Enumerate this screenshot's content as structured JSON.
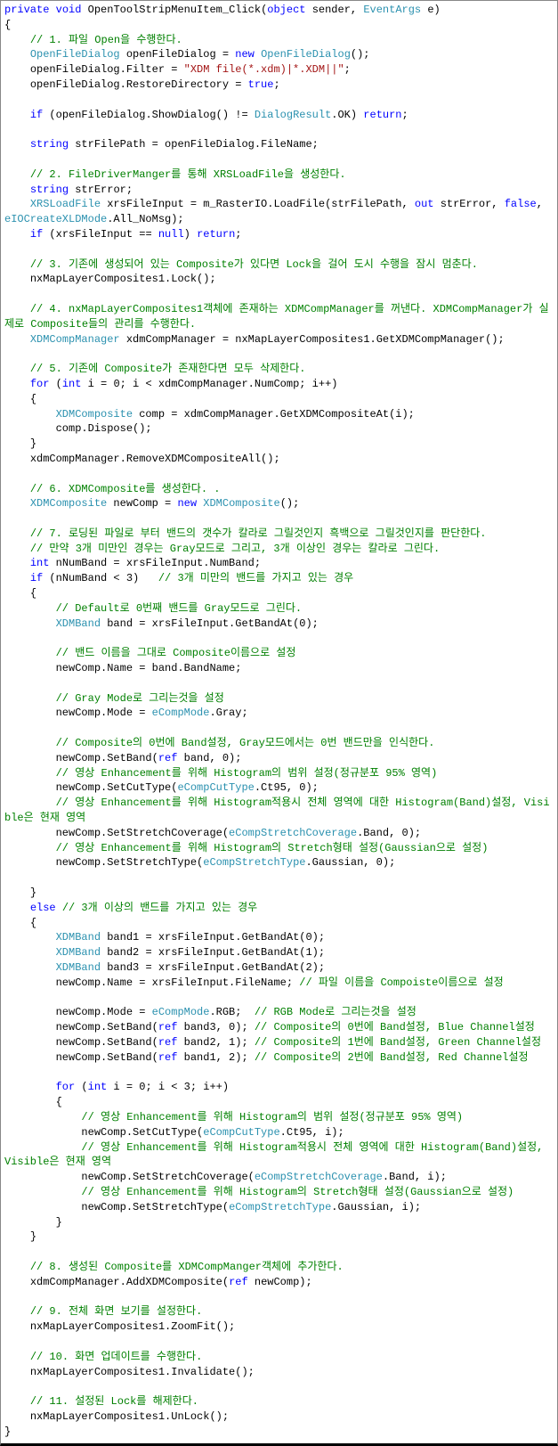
{
  "code": {
    "lines": [
      [
        {
          "t": "private",
          "c": "kw"
        },
        {
          "t": " ",
          "c": "plain"
        },
        {
          "t": "void",
          "c": "kw"
        },
        {
          "t": " OpenToolStripMenuItem_Click(",
          "c": "plain"
        },
        {
          "t": "object",
          "c": "kw"
        },
        {
          "t": " sender, ",
          "c": "plain"
        },
        {
          "t": "EventArgs",
          "c": "type"
        },
        {
          "t": " e)",
          "c": "plain"
        }
      ],
      [
        {
          "t": "{",
          "c": "plain"
        }
      ],
      [
        {
          "t": "    ",
          "c": "plain"
        },
        {
          "t": "// 1. 파일 Open을 수행한다.",
          "c": "cmt"
        }
      ],
      [
        {
          "t": "    ",
          "c": "plain"
        },
        {
          "t": "OpenFileDialog",
          "c": "type"
        },
        {
          "t": " openFileDialog = ",
          "c": "plain"
        },
        {
          "t": "new",
          "c": "kw"
        },
        {
          "t": " ",
          "c": "plain"
        },
        {
          "t": "OpenFileDialog",
          "c": "type"
        },
        {
          "t": "();",
          "c": "plain"
        }
      ],
      [
        {
          "t": "    openFileDialog.Filter = ",
          "c": "plain"
        },
        {
          "t": "\"XDM file(*.xdm)|*.XDM||\"",
          "c": "str"
        },
        {
          "t": ";",
          "c": "plain"
        }
      ],
      [
        {
          "t": "    openFileDialog.RestoreDirectory = ",
          "c": "plain"
        },
        {
          "t": "true",
          "c": "kw"
        },
        {
          "t": ";",
          "c": "plain"
        }
      ],
      [
        {
          "t": " ",
          "c": "plain"
        }
      ],
      [
        {
          "t": "    ",
          "c": "plain"
        },
        {
          "t": "if",
          "c": "kw"
        },
        {
          "t": " (openFileDialog.ShowDialog() != ",
          "c": "plain"
        },
        {
          "t": "DialogResult",
          "c": "type"
        },
        {
          "t": ".OK) ",
          "c": "plain"
        },
        {
          "t": "return",
          "c": "kw"
        },
        {
          "t": ";",
          "c": "plain"
        }
      ],
      [
        {
          "t": " ",
          "c": "plain"
        }
      ],
      [
        {
          "t": "    ",
          "c": "plain"
        },
        {
          "t": "string",
          "c": "kw"
        },
        {
          "t": " strFilePath = openFileDialog.FileName;",
          "c": "plain"
        }
      ],
      [
        {
          "t": " ",
          "c": "plain"
        }
      ],
      [
        {
          "t": "    ",
          "c": "plain"
        },
        {
          "t": "// 2. FileDriverManger를 통해 XRSLoadFile을 생성한다.",
          "c": "cmt"
        }
      ],
      [
        {
          "t": "    ",
          "c": "plain"
        },
        {
          "t": "string",
          "c": "kw"
        },
        {
          "t": " strError;",
          "c": "plain"
        }
      ],
      [
        {
          "t": "    ",
          "c": "plain"
        },
        {
          "t": "XRSLoadFile",
          "c": "type"
        },
        {
          "t": " xrsFileInput = m_RasterIO.LoadFile(strFilePath, ",
          "c": "plain"
        },
        {
          "t": "out",
          "c": "kw"
        },
        {
          "t": " strError, ",
          "c": "plain"
        },
        {
          "t": "false",
          "c": "kw"
        },
        {
          "t": ", ",
          "c": "plain"
        },
        {
          "t": "eIOCreateXLDMode",
          "c": "type"
        },
        {
          "t": ".All_NoMsg);",
          "c": "plain"
        }
      ],
      [
        {
          "t": "    ",
          "c": "plain"
        },
        {
          "t": "if",
          "c": "kw"
        },
        {
          "t": " (xrsFileInput == ",
          "c": "plain"
        },
        {
          "t": "null",
          "c": "kw"
        },
        {
          "t": ") ",
          "c": "plain"
        },
        {
          "t": "return",
          "c": "kw"
        },
        {
          "t": ";",
          "c": "plain"
        }
      ],
      [
        {
          "t": " ",
          "c": "plain"
        }
      ],
      [
        {
          "t": "    ",
          "c": "plain"
        },
        {
          "t": "// 3. 기존에 생성되어 있는 Composite가 있다면 Lock을 걸어 도시 수행을 잠시 멈춘다.",
          "c": "cmt"
        }
      ],
      [
        {
          "t": "    nxMapLayerComposites1.Lock();",
          "c": "plain"
        }
      ],
      [
        {
          "t": " ",
          "c": "plain"
        }
      ],
      [
        {
          "t": "    ",
          "c": "plain"
        },
        {
          "t": "// 4. nxMapLayerComposites1객체에 존재하는 XDMCompManager를 꺼낸다. XDMCompManager가 실제로 Composite들의 관리를 수행한다.",
          "c": "cmt"
        }
      ],
      [
        {
          "t": "    ",
          "c": "plain"
        },
        {
          "t": "XDMCompManager",
          "c": "type"
        },
        {
          "t": " xdmCompManager = nxMapLayerComposites1.GetXDMCompManager();",
          "c": "plain"
        }
      ],
      [
        {
          "t": " ",
          "c": "plain"
        }
      ],
      [
        {
          "t": "    ",
          "c": "plain"
        },
        {
          "t": "// 5. 기존에 Composite가 존재한다면 모두 삭제한다.",
          "c": "cmt"
        }
      ],
      [
        {
          "t": "    ",
          "c": "plain"
        },
        {
          "t": "for",
          "c": "kw"
        },
        {
          "t": " (",
          "c": "plain"
        },
        {
          "t": "int",
          "c": "kw"
        },
        {
          "t": " i = 0; i < xdmCompManager.NumComp; i++)",
          "c": "plain"
        }
      ],
      [
        {
          "t": "    {",
          "c": "plain"
        }
      ],
      [
        {
          "t": "        ",
          "c": "plain"
        },
        {
          "t": "XDMComposite",
          "c": "type"
        },
        {
          "t": " comp = xdmCompManager.GetXDMCompositeAt(i);",
          "c": "plain"
        }
      ],
      [
        {
          "t": "        comp.Dispose();",
          "c": "plain"
        }
      ],
      [
        {
          "t": "    }",
          "c": "plain"
        }
      ],
      [
        {
          "t": "    xdmCompManager.RemoveXDMCompositeAll();",
          "c": "plain"
        }
      ],
      [
        {
          "t": " ",
          "c": "plain"
        }
      ],
      [
        {
          "t": "    ",
          "c": "plain"
        },
        {
          "t": "// 6. XDMComposite를 생성한다. .",
          "c": "cmt"
        }
      ],
      [
        {
          "t": "    ",
          "c": "plain"
        },
        {
          "t": "XDMComposite",
          "c": "type"
        },
        {
          "t": " newComp = ",
          "c": "plain"
        },
        {
          "t": "new",
          "c": "kw"
        },
        {
          "t": " ",
          "c": "plain"
        },
        {
          "t": "XDMComposite",
          "c": "type"
        },
        {
          "t": "();",
          "c": "plain"
        }
      ],
      [
        {
          "t": " ",
          "c": "plain"
        }
      ],
      [
        {
          "t": "    ",
          "c": "plain"
        },
        {
          "t": "// 7. 로딩된 파일로 부터 밴드의 갯수가 칼라로 그릴것인지 흑백으로 그릴것인지를 판단한다.",
          "c": "cmt"
        }
      ],
      [
        {
          "t": "    ",
          "c": "plain"
        },
        {
          "t": "// 만약 3개 미만인 경우는 Gray모드로 그리고, 3개 이상인 경우는 칼라로 그린다.",
          "c": "cmt"
        }
      ],
      [
        {
          "t": "    ",
          "c": "plain"
        },
        {
          "t": "int",
          "c": "kw"
        },
        {
          "t": " nNumBand = xrsFileInput.NumBand;",
          "c": "plain"
        }
      ],
      [
        {
          "t": "    ",
          "c": "plain"
        },
        {
          "t": "if",
          "c": "kw"
        },
        {
          "t": " (nNumBand < 3)   ",
          "c": "plain"
        },
        {
          "t": "// 3개 미만의 밴드를 가지고 있는 경우",
          "c": "cmt"
        }
      ],
      [
        {
          "t": "    {",
          "c": "plain"
        }
      ],
      [
        {
          "t": "        ",
          "c": "plain"
        },
        {
          "t": "// Default로 0번째 밴드를 Gray모드로 그린다.",
          "c": "cmt"
        }
      ],
      [
        {
          "t": "        ",
          "c": "plain"
        },
        {
          "t": "XDMBand",
          "c": "type"
        },
        {
          "t": " band = xrsFileInput.GetBandAt(0);",
          "c": "plain"
        }
      ],
      [
        {
          "t": " ",
          "c": "plain"
        }
      ],
      [
        {
          "t": "        ",
          "c": "plain"
        },
        {
          "t": "// 밴드 이름을 그대로 Composite이름으로 설정",
          "c": "cmt"
        }
      ],
      [
        {
          "t": "        newComp.Name = band.BandName;",
          "c": "plain"
        }
      ],
      [
        {
          "t": " ",
          "c": "plain"
        }
      ],
      [
        {
          "t": "        ",
          "c": "plain"
        },
        {
          "t": "// Gray Mode로 그리는것을 설정",
          "c": "cmt"
        }
      ],
      [
        {
          "t": "        newComp.Mode = ",
          "c": "plain"
        },
        {
          "t": "eCompMode",
          "c": "type"
        },
        {
          "t": ".Gray;",
          "c": "plain"
        }
      ],
      [
        {
          "t": " ",
          "c": "plain"
        }
      ],
      [
        {
          "t": "        ",
          "c": "plain"
        },
        {
          "t": "// Composite의 0번에 Band설정, Gray모드에서는 0번 밴드만을 인식한다.",
          "c": "cmt"
        }
      ],
      [
        {
          "t": "        newComp.SetBand(",
          "c": "plain"
        },
        {
          "t": "ref",
          "c": "kw"
        },
        {
          "t": " band, 0);",
          "c": "plain"
        }
      ],
      [
        {
          "t": "        ",
          "c": "plain"
        },
        {
          "t": "// 영상 Enhancement를 위해 Histogram의 범위 설정(정규분포 95% 영역)",
          "c": "cmt"
        }
      ],
      [
        {
          "t": "        newComp.SetCutType(",
          "c": "plain"
        },
        {
          "t": "eCompCutType",
          "c": "type"
        },
        {
          "t": ".Ct95, 0);",
          "c": "plain"
        }
      ],
      [
        {
          "t": "        ",
          "c": "plain"
        },
        {
          "t": "// 영상 Enhancement를 위해 Histogram적용시 전체 영역에 대한 Histogram(Band)설정, Visible은 현재 영역",
          "c": "cmt"
        }
      ],
      [
        {
          "t": "        newComp.SetStretchCoverage(",
          "c": "plain"
        },
        {
          "t": "eCompStretchCoverage",
          "c": "type"
        },
        {
          "t": ".Band, 0);",
          "c": "plain"
        }
      ],
      [
        {
          "t": "        ",
          "c": "plain"
        },
        {
          "t": "// 영상 Enhancement를 위해 Histogram의 Stretch형태 설정(Gaussian으로 설정)",
          "c": "cmt"
        }
      ],
      [
        {
          "t": "        newComp.SetStretchType(",
          "c": "plain"
        },
        {
          "t": "eCompStretchType",
          "c": "type"
        },
        {
          "t": ".Gaussian, 0);",
          "c": "plain"
        }
      ],
      [
        {
          "t": " ",
          "c": "plain"
        }
      ],
      [
        {
          "t": "    }",
          "c": "plain"
        }
      ],
      [
        {
          "t": "    ",
          "c": "plain"
        },
        {
          "t": "else",
          "c": "kw"
        },
        {
          "t": " ",
          "c": "plain"
        },
        {
          "t": "// 3개 이상의 밴드를 가지고 있는 경우",
          "c": "cmt"
        }
      ],
      [
        {
          "t": "    {",
          "c": "plain"
        }
      ],
      [
        {
          "t": "        ",
          "c": "plain"
        },
        {
          "t": "XDMBand",
          "c": "type"
        },
        {
          "t": " band1 = xrsFileInput.GetBandAt(0);",
          "c": "plain"
        }
      ],
      [
        {
          "t": "        ",
          "c": "plain"
        },
        {
          "t": "XDMBand",
          "c": "type"
        },
        {
          "t": " band2 = xrsFileInput.GetBandAt(1);",
          "c": "plain"
        }
      ],
      [
        {
          "t": "        ",
          "c": "plain"
        },
        {
          "t": "XDMBand",
          "c": "type"
        },
        {
          "t": " band3 = xrsFileInput.GetBandAt(2);",
          "c": "plain"
        }
      ],
      [
        {
          "t": "        newComp.Name = xrsFileInput.FileName; ",
          "c": "plain"
        },
        {
          "t": "// 파일 이름을 Compoiste이름으로 설정",
          "c": "cmt"
        }
      ],
      [
        {
          "t": " ",
          "c": "plain"
        }
      ],
      [
        {
          "t": "        newComp.Mode = ",
          "c": "plain"
        },
        {
          "t": "eCompMode",
          "c": "type"
        },
        {
          "t": ".RGB;  ",
          "c": "plain"
        },
        {
          "t": "// RGB Mode로 그리는것을 설정",
          "c": "cmt"
        }
      ],
      [
        {
          "t": "        newComp.SetBand(",
          "c": "plain"
        },
        {
          "t": "ref",
          "c": "kw"
        },
        {
          "t": " band3, 0); ",
          "c": "plain"
        },
        {
          "t": "// Composite의 0번에 Band설정, Blue Channel설정",
          "c": "cmt"
        }
      ],
      [
        {
          "t": "        newComp.SetBand(",
          "c": "plain"
        },
        {
          "t": "ref",
          "c": "kw"
        },
        {
          "t": " band2, 1); ",
          "c": "plain"
        },
        {
          "t": "// Composite의 1번에 Band설정, Green Channel설정",
          "c": "cmt"
        }
      ],
      [
        {
          "t": "        newComp.SetBand(",
          "c": "plain"
        },
        {
          "t": "ref",
          "c": "kw"
        },
        {
          "t": " band1, 2); ",
          "c": "plain"
        },
        {
          "t": "// Composite의 2번에 Band설정, Red Channel설정",
          "c": "cmt"
        }
      ],
      [
        {
          "t": " ",
          "c": "plain"
        }
      ],
      [
        {
          "t": "        ",
          "c": "plain"
        },
        {
          "t": "for",
          "c": "kw"
        },
        {
          "t": " (",
          "c": "plain"
        },
        {
          "t": "int",
          "c": "kw"
        },
        {
          "t": " i = 0; i < 3; i++)",
          "c": "plain"
        }
      ],
      [
        {
          "t": "        {",
          "c": "plain"
        }
      ],
      [
        {
          "t": "            ",
          "c": "plain"
        },
        {
          "t": "// 영상 Enhancement를 위해 Histogram의 범위 설정(정규분포 95% 영역)",
          "c": "cmt"
        }
      ],
      [
        {
          "t": "            newComp.SetCutType(",
          "c": "plain"
        },
        {
          "t": "eCompCutType",
          "c": "type"
        },
        {
          "t": ".Ct95, i);",
          "c": "plain"
        }
      ],
      [
        {
          "t": "            ",
          "c": "plain"
        },
        {
          "t": "// 영상 Enhancement를 위해 Histogram적용시 전체 영역에 대한 Histogram(Band)설정, Visible은 현재 영역",
          "c": "cmt"
        }
      ],
      [
        {
          "t": "            newComp.SetStretchCoverage(",
          "c": "plain"
        },
        {
          "t": "eCompStretchCoverage",
          "c": "type"
        },
        {
          "t": ".Band, i);",
          "c": "plain"
        }
      ],
      [
        {
          "t": "            ",
          "c": "plain"
        },
        {
          "t": "// 영상 Enhancement를 위해 Histogram의 Stretch형태 설정(Gaussian으로 설정)",
          "c": "cmt"
        }
      ],
      [
        {
          "t": "            newComp.SetStretchType(",
          "c": "plain"
        },
        {
          "t": "eCompStretchType",
          "c": "type"
        },
        {
          "t": ".Gaussian, i);",
          "c": "plain"
        }
      ],
      [
        {
          "t": "        }",
          "c": "plain"
        }
      ],
      [
        {
          "t": "    }",
          "c": "plain"
        }
      ],
      [
        {
          "t": " ",
          "c": "plain"
        }
      ],
      [
        {
          "t": "    ",
          "c": "plain"
        },
        {
          "t": "// 8. 생성된 Composite를 XDMCompManger객체에 추가한다.",
          "c": "cmt"
        }
      ],
      [
        {
          "t": "    xdmCompManager.AddXDMComposite(",
          "c": "plain"
        },
        {
          "t": "ref",
          "c": "kw"
        },
        {
          "t": " newComp);",
          "c": "plain"
        }
      ],
      [
        {
          "t": " ",
          "c": "plain"
        }
      ],
      [
        {
          "t": "    ",
          "c": "plain"
        },
        {
          "t": "// 9. 전체 화면 보기를 설정한다.",
          "c": "cmt"
        }
      ],
      [
        {
          "t": "    nxMapLayerComposites1.ZoomFit();",
          "c": "plain"
        }
      ],
      [
        {
          "t": " ",
          "c": "plain"
        }
      ],
      [
        {
          "t": "    ",
          "c": "plain"
        },
        {
          "t": "// 10. 화면 업데이트를 수행한다.",
          "c": "cmt"
        }
      ],
      [
        {
          "t": "    nxMapLayerComposites1.Invalidate();",
          "c": "plain"
        }
      ],
      [
        {
          "t": " ",
          "c": "plain"
        }
      ],
      [
        {
          "t": "    ",
          "c": "plain"
        },
        {
          "t": "// 11. 설정된 Lock를 해제한다.",
          "c": "cmt"
        }
      ],
      [
        {
          "t": "    nxMapLayerComposites1.UnLock();",
          "c": "plain"
        }
      ],
      [
        {
          "t": "}",
          "c": "plain"
        }
      ]
    ]
  }
}
